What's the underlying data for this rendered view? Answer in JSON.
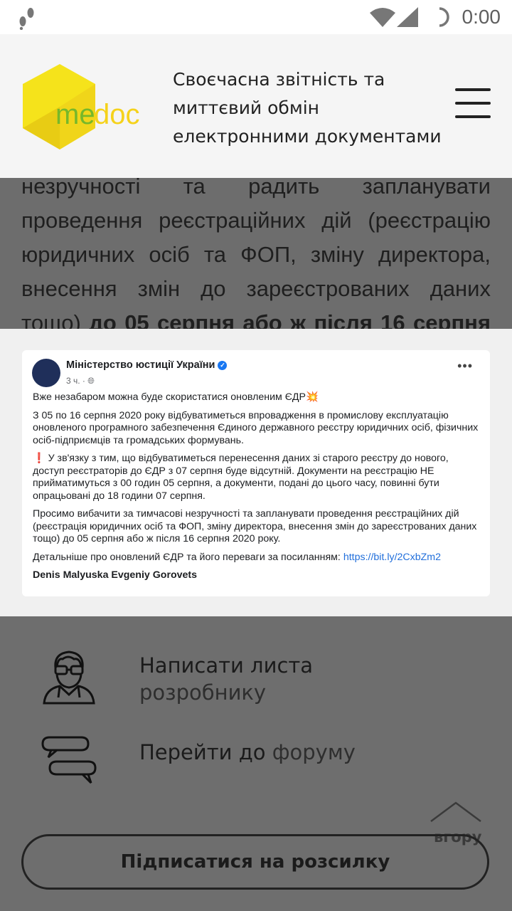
{
  "status_bar": {
    "time": "0:00"
  },
  "article": {
    "lines": [
      "незручності та радить запланувати",
      "проведення реєстраційних дій (реєстрацію",
      "юридичних осіб та ФОП, зміну директора,",
      "внесення змін до зареєстрованих даних"
    ],
    "last_plain": "тощо) ",
    "last_bold": "до 05 серпня або ж після 16 серпня"
  },
  "header": {
    "logo_text_me": "me",
    "logo_text_doc": "doc",
    "tagline": [
      "Своєчасна звітність та",
      "миттєвий обмін",
      "електронними документами"
    ]
  },
  "post": {
    "author": "Міністерство юстиції України",
    "time": "3 ч. · ",
    "p1": "Вже незабаром можна буде скористатися оновленим ЄДР💥",
    "p2": "З 05 по 16 серпня 2020 року відбуватиметься впровадження в промислову експлуатацію оновленого програмного забезпечення Єдиного державного реєстру юридичних осіб, фізичних осіб-підприємців та громадських формувань.",
    "p3": "❗ У зв'язку з тим, що відбуватиметься перенесення даних зі старого реєстру до нового, доступ реєстраторів до ЄДР з 07 серпня буде відсутній. Документи на реєстрацію НЕ прийматимуться з 00 годин 05 серпня, а документи, подані до цього часу, повинні бути опрацьовані до 18 години 07 серпня.",
    "p4": "Просимо вибачити за тимчасові незручності та запланувати проведення реєстраційних дій (реєстрація юридичних осіб та ФОП, зміну директора, внесення змін до зареєстрованих даних тощо) до 05 серпня або ж після 16 серпня 2020 року.",
    "p5_text": "Детальніше про оновлений ЄДР та його переваги за посиланням: ",
    "p5_link": "https://bit.ly/2CxbZm2",
    "tags": "Denis Malyuska Evgeniy Gorovets"
  },
  "contacts": {
    "write_line1": "Написати листа",
    "write_line2": "розробнику",
    "forum_a": "Перейти до ",
    "forum_b": "форуму"
  },
  "subscribe_label": "Підписатися на розсилку",
  "to_top_label": "вгору",
  "colors": {
    "logo_yellow": "#f5e31b",
    "logo_green": "#76b82a",
    "link": "#216fdb",
    "overlay": "#6e6e6e"
  }
}
